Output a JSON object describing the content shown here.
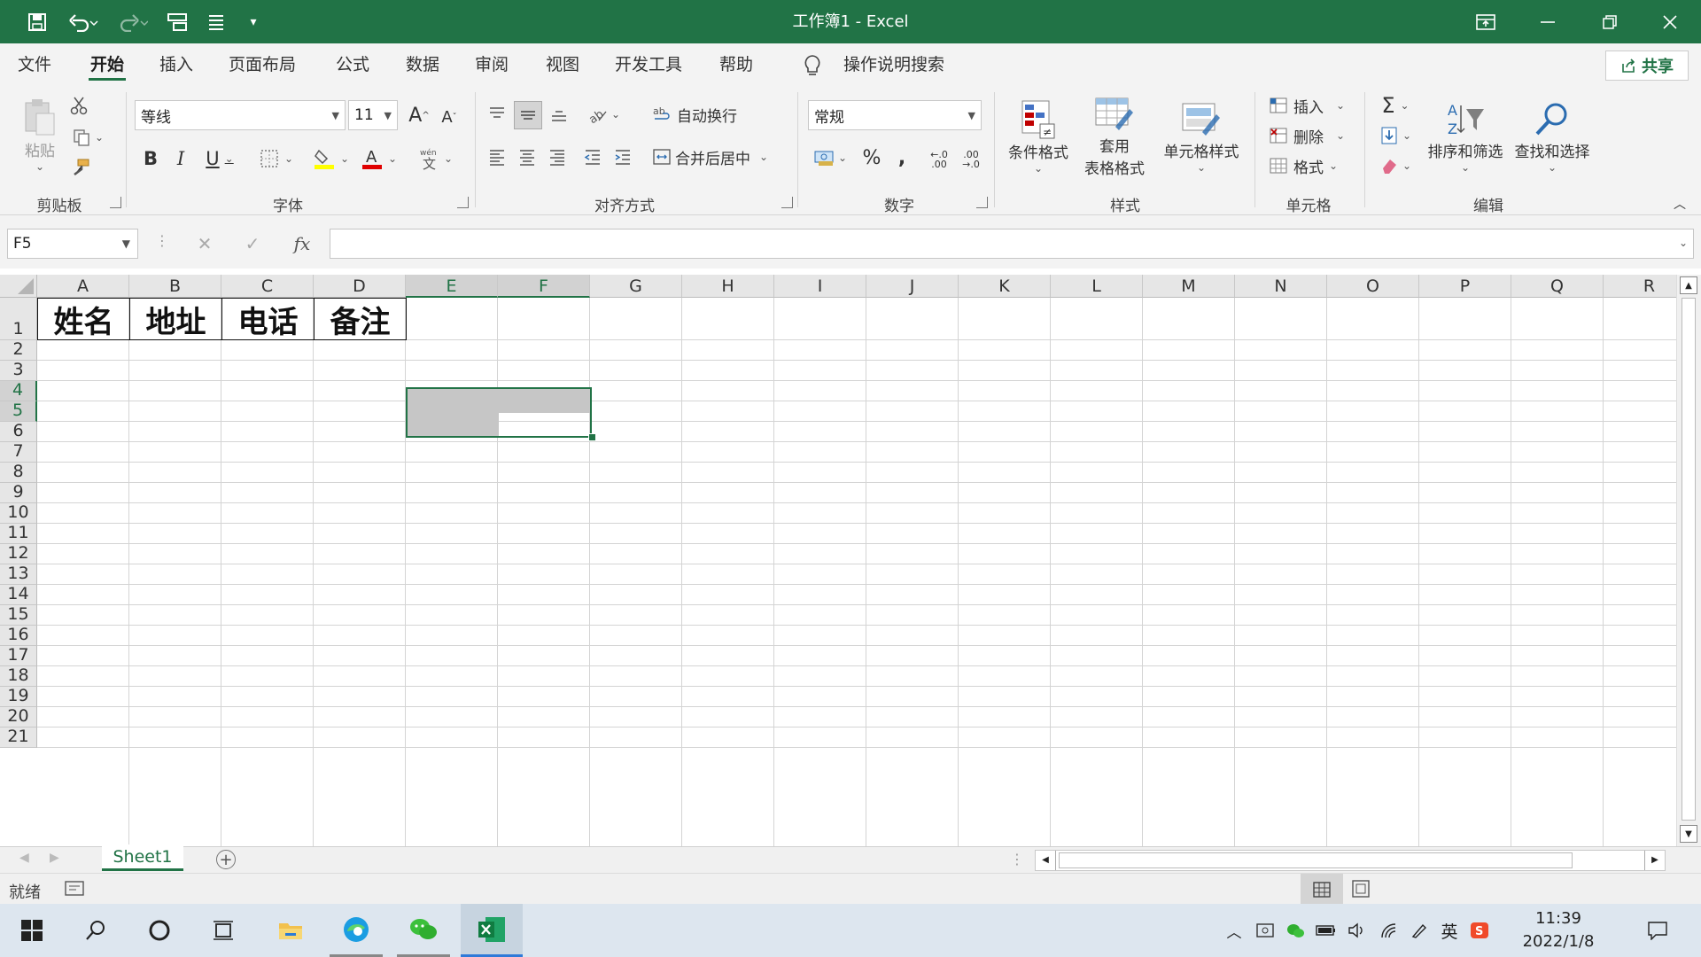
{
  "window": {
    "title": "工作簿1  -  Excel"
  },
  "colors": {
    "accent": "#217346"
  },
  "quick_access": {
    "icons": [
      "save-icon",
      "undo-icon",
      "redo-icon",
      "touch-mode-icon",
      "customize-icon"
    ]
  },
  "tabs": [
    "文件",
    "开始",
    "插入",
    "页面布局",
    "公式",
    "数据",
    "审阅",
    "视图",
    "开发工具",
    "帮助"
  ],
  "active_tab": "开始",
  "search_label": "操作说明搜索",
  "share_label": "共享",
  "ribbon": {
    "clipboard": {
      "label": "剪贴板",
      "paste": "粘贴"
    },
    "font": {
      "label": "字体",
      "name": "等线",
      "size": "11"
    },
    "alignment": {
      "label": "对齐方式",
      "wrap": "自动换行",
      "merge": "合并后居中"
    },
    "number": {
      "label": "数字",
      "format": "常规"
    },
    "styles": {
      "label": "样式",
      "conditional": "条件格式",
      "table_l1": "套用",
      "table_l2": "表格格式",
      "cell_styles": "单元格样式"
    },
    "cells": {
      "label": "单元格",
      "insert": "插入",
      "delete": "删除",
      "format": "格式"
    },
    "editing": {
      "label": "编辑",
      "sort": "排序和筛选",
      "find": "查找和选择"
    }
  },
  "formula_bar": {
    "name_box": "F5",
    "fx": "fx",
    "content": ""
  },
  "columns": [
    "A",
    "B",
    "C",
    "D",
    "E",
    "F",
    "G",
    "H",
    "I",
    "J",
    "K",
    "L",
    "M",
    "N",
    "O",
    "P",
    "Q",
    "R"
  ],
  "rows": [
    "1",
    "2",
    "3",
    "4",
    "5",
    "6",
    "7",
    "8",
    "9",
    "10",
    "11",
    "12",
    "13",
    "14",
    "15",
    "16",
    "17",
    "18",
    "19",
    "20",
    "21"
  ],
  "cells": {
    "A1": "姓名",
    "B1": "地址",
    "C1": "电话",
    "D1": "备注"
  },
  "sheets": [
    "Sheet1"
  ],
  "status": {
    "text": "就绪"
  },
  "taskbar": {
    "time": "11:39",
    "date": "2022/1/8",
    "ime": "英"
  }
}
